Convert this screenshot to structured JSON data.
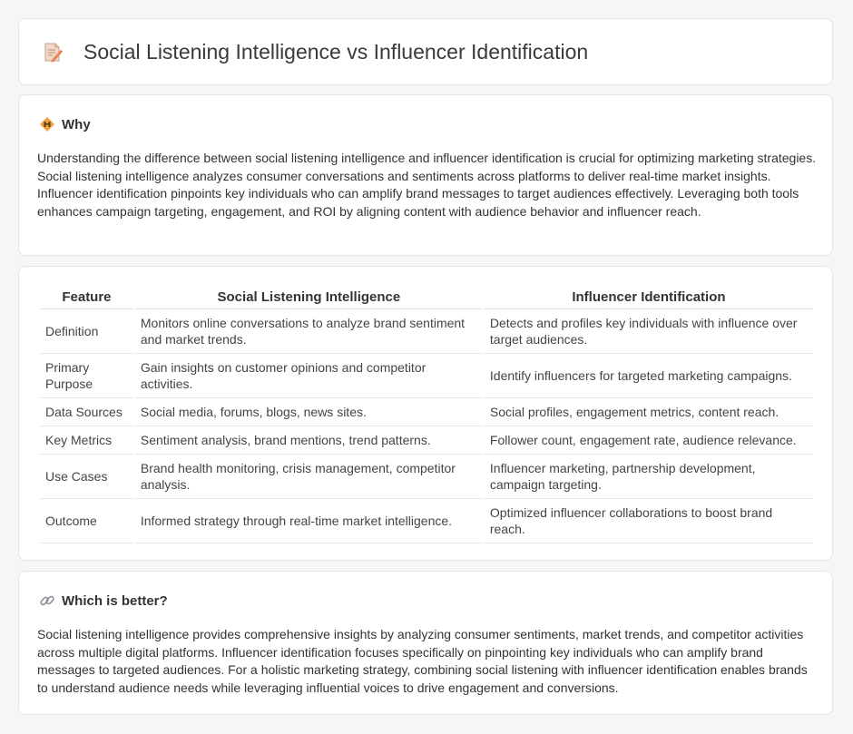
{
  "header": {
    "title": "Social Listening Intelligence vs Influencer Identification",
    "icon": "document-pencil-icon"
  },
  "why": {
    "icon": "diamond-warning-icon",
    "heading": "Why",
    "text": "Understanding the difference between social listening intelligence and influencer identification is crucial for optimizing marketing strategies. Social listening intelligence analyzes consumer conversations and sentiments across platforms to deliver real-time market insights. Influencer identification pinpoints key individuals who can amplify brand messages to target audiences effectively. Leveraging both tools enhances campaign targeting, engagement, and ROI by aligning content with audience behavior and influencer reach."
  },
  "table": {
    "headers": [
      "Feature",
      "Social Listening Intelligence",
      "Influencer Identification"
    ],
    "rows": [
      {
        "feature": "Definition",
        "social": "Monitors online conversations to analyze brand sentiment and market trends.",
        "influencer": "Detects and profiles key individuals with influence over target audiences."
      },
      {
        "feature": "Primary Purpose",
        "social": "Gain insights on customer opinions and competitor activities.",
        "influencer": "Identify influencers for targeted marketing campaigns."
      },
      {
        "feature": "Data Sources",
        "social": "Social media, forums, blogs, news sites.",
        "influencer": "Social profiles, engagement metrics, content reach."
      },
      {
        "feature": "Key Metrics",
        "social": "Sentiment analysis, brand mentions, trend patterns.",
        "influencer": "Follower count, engagement rate, audience relevance."
      },
      {
        "feature": "Use Cases",
        "social": "Brand health monitoring, crisis management, competitor analysis.",
        "influencer": "Influencer marketing, partnership development, campaign targeting."
      },
      {
        "feature": "Outcome",
        "social": "Informed strategy through real-time market intelligence.",
        "influencer": "Optimized influencer collaborations to boost brand reach."
      }
    ]
  },
  "better": {
    "icon": "link-icon",
    "heading": "Which is better?",
    "text": "Social listening intelligence provides comprehensive insights by analyzing consumer sentiments, market trends, and competitor activities across multiple digital platforms. Influencer identification focuses specifically on pinpointing key individuals who can amplify brand messages to targeted audiences. For a holistic marketing strategy, combining social listening with influencer identification enables brands to understand audience needs while leveraging influential voices to drive engagement and conversions."
  },
  "colors": {
    "background": "#f5f6f8",
    "card": "#ffffff",
    "text": "#333333",
    "icon_accent": "#e8834a"
  }
}
